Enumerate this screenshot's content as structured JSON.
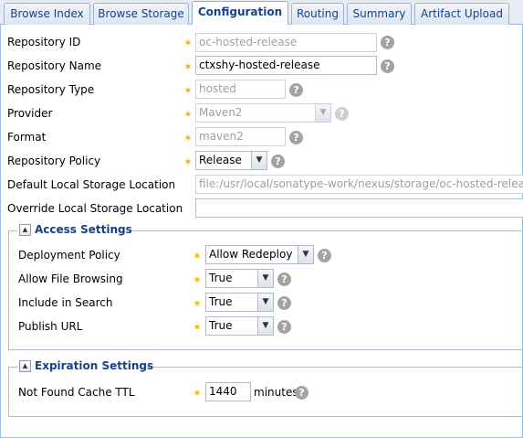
{
  "tabs": [
    {
      "label": "Browse Index"
    },
    {
      "label": "Browse Storage"
    },
    {
      "label": "Configuration"
    },
    {
      "label": "Routing"
    },
    {
      "label": "Summary"
    },
    {
      "label": "Artifact Upload"
    }
  ],
  "form": {
    "repository_id": {
      "label": "Repository ID",
      "value": "oc-hosted-release"
    },
    "repository_name": {
      "label": "Repository Name",
      "value": "ctxshy-hosted-release"
    },
    "repository_type": {
      "label": "Repository Type",
      "value": "hosted"
    },
    "provider": {
      "label": "Provider",
      "value": "Maven2"
    },
    "format": {
      "label": "Format",
      "value": "maven2"
    },
    "repository_policy": {
      "label": "Repository Policy",
      "value": "Release"
    },
    "default_storage": {
      "label": "Default Local Storage Location",
      "value": "file:/usr/local/sonatype-work/nexus/storage/oc-hosted-release"
    },
    "override_storage": {
      "label": "Override Local Storage Location",
      "value": ""
    }
  },
  "access_settings": {
    "title": "Access Settings",
    "deployment_policy": {
      "label": "Deployment Policy",
      "value": "Allow Redeploy"
    },
    "allow_file_browsing": {
      "label": "Allow File Browsing",
      "value": "True"
    },
    "include_in_search": {
      "label": "Include in Search",
      "value": "True"
    },
    "publish_url": {
      "label": "Publish URL",
      "value": "True"
    }
  },
  "expiration_settings": {
    "title": "Expiration Settings",
    "not_found_cache_ttl": {
      "label": "Not Found Cache TTL",
      "value": "1440",
      "unit": "minutes"
    }
  },
  "icons": {
    "required": "star-icon",
    "help": "help-icon",
    "dropdown": "chevron-down-icon",
    "collapse": "chevron-up-icon"
  },
  "colors": {
    "required_star": "#f2b300",
    "tab_text": "#15428b",
    "panel_border": "#99bbe8"
  }
}
